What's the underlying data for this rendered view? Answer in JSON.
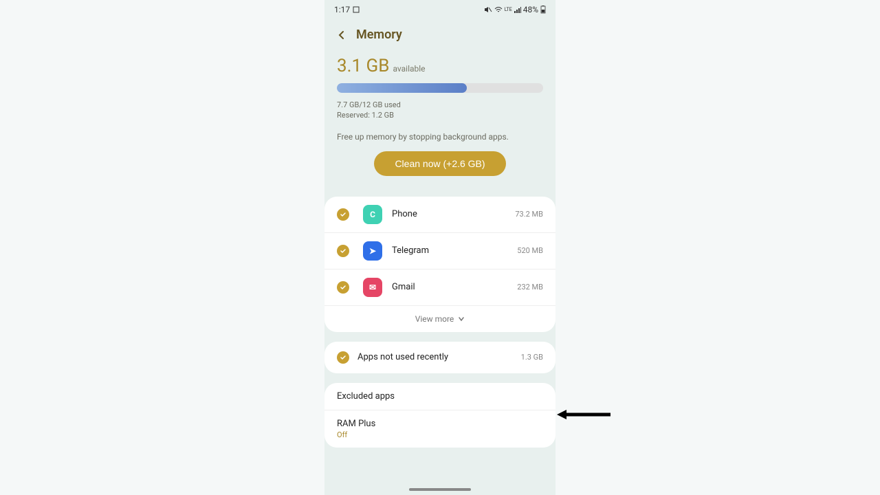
{
  "status": {
    "time": "1:17",
    "battery": "48%"
  },
  "header": {
    "title": "Memory"
  },
  "summary": {
    "available_value": "3.1 GB",
    "available_label": "available",
    "progress_percent": 63,
    "used_line": "7.7 GB/12 GB used",
    "reserved_line": "Reserved: 1.2 GB",
    "hint": "Free up memory by stopping background apps.",
    "clean_button": "Clean now (+2.6 GB)"
  },
  "apps": [
    {
      "name": "Phone",
      "size": "73.2 MB",
      "icon_bg": "#3fd1b3",
      "glyph": "C"
    },
    {
      "name": "Telegram",
      "size": "520 MB",
      "icon_bg": "#2f6fe8",
      "glyph": "➤"
    },
    {
      "name": "Gmail",
      "size": "232 MB",
      "icon_bg": "#e54565",
      "glyph": "✉"
    }
  ],
  "view_more": "View more",
  "not_used": {
    "label": "Apps not used recently",
    "size": "1.3 GB"
  },
  "settings": {
    "excluded": "Excluded apps",
    "ram_plus_title": "RAM Plus",
    "ram_plus_state": "Off"
  }
}
